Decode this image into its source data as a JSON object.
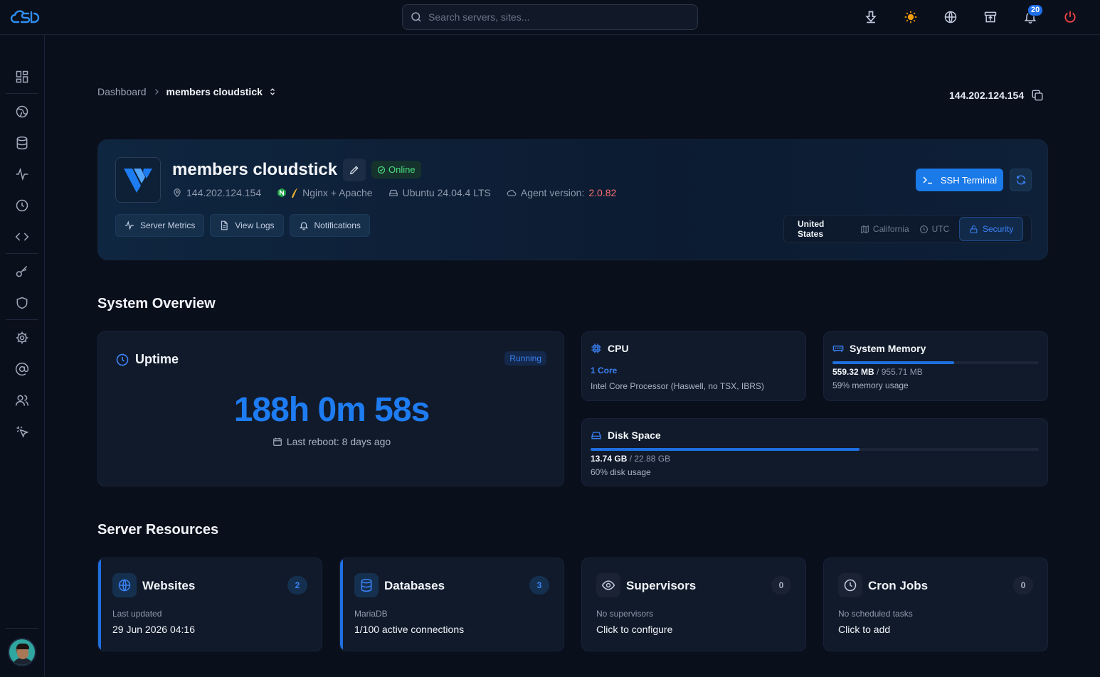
{
  "search": {
    "placeholder": "Search servers, sites..."
  },
  "notifications": {
    "count": "20"
  },
  "breadcrumb": {
    "root": "Dashboard",
    "current": "members cloudstick"
  },
  "header_ip": "144.202.124.154",
  "server": {
    "name": "members cloudstick",
    "status": "Online",
    "ip": "144.202.124.154",
    "stack": "Nginx + Apache",
    "os": "Ubuntu 24.04.4 LTS",
    "agent_label": "Agent version:",
    "agent_version": "2.0.82",
    "actions": {
      "metrics": "Server Metrics",
      "logs": "View Logs",
      "notifications": "Notifications"
    },
    "ssh_label": "SSH Terminal",
    "location": {
      "country": "United States",
      "region": "California",
      "timezone": "UTC",
      "security": "Security"
    }
  },
  "overview": {
    "title": "System Overview",
    "uptime": {
      "title": "Uptime",
      "status": "Running",
      "value": "188h 0m 58s",
      "last_reboot": "Last reboot: 8 days ago"
    },
    "cpu": {
      "title": "CPU",
      "cores": "1 Core",
      "model": "Intel Core Processor (Haswell, no TSX, IBRS)"
    },
    "memory": {
      "title": "System Memory",
      "used": "559.32 MB",
      "total": "/ 955.71 MB",
      "usage": "59% memory usage",
      "fraction": 0.59
    },
    "disk": {
      "title": "Disk Space",
      "used": "13.74 GB",
      "total": "/ 22.88 GB",
      "usage": "60% disk usage",
      "fraction": 0.6
    }
  },
  "resources": {
    "title": "Server Resources",
    "websites": {
      "title": "Websites",
      "count": "2",
      "sub": "Last updated",
      "main": "29 Jun 2026 04:16"
    },
    "databases": {
      "title": "Databases",
      "count": "3",
      "sub": "MariaDB",
      "main": "1/100 active connections"
    },
    "supervisors": {
      "title": "Supervisors",
      "count": "0",
      "sub": "No supervisors",
      "main": "Click to configure"
    },
    "cron": {
      "title": "Cron Jobs",
      "count": "0",
      "sub": "No scheduled tasks",
      "main": "Click to add"
    }
  },
  "colors": {
    "accent": "#1e7cf2",
    "online": "#4ade80",
    "agent_version": "#f87171",
    "power": "#ef4444",
    "sun": "#f59e0b"
  }
}
